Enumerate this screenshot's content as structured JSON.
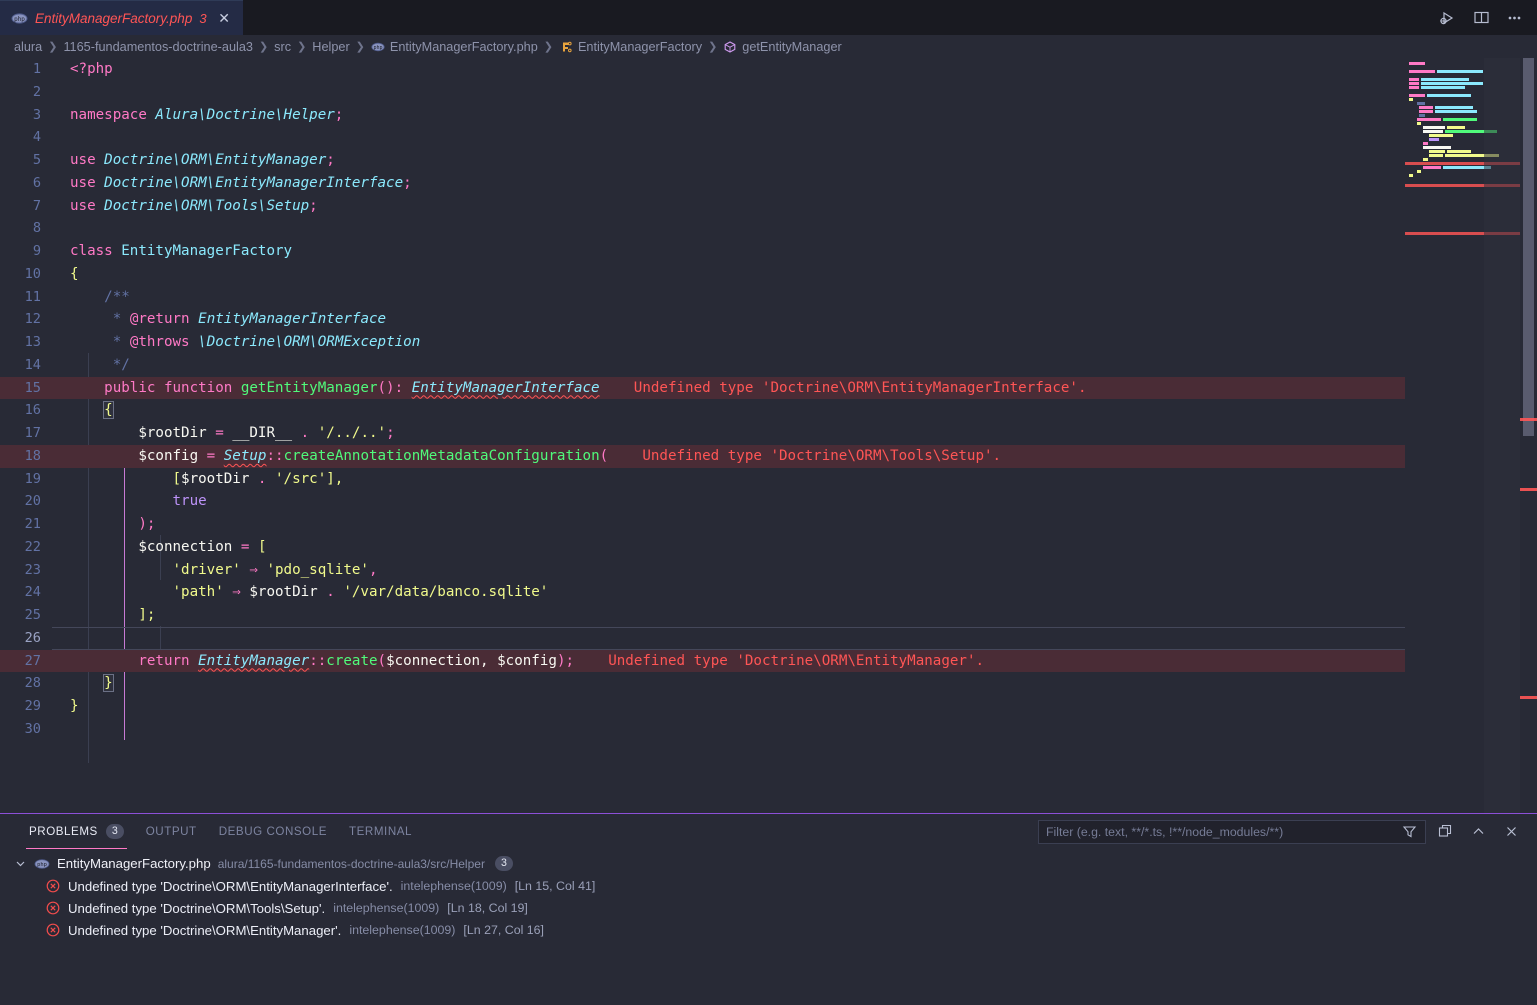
{
  "tab": {
    "icon": "php-elephant-icon",
    "label": "EntityManagerFactory.php",
    "error_badge": "3",
    "close": "✕"
  },
  "editor_actions": [
    {
      "name": "run-and-debug-icon",
      "label": "Run or Debug"
    },
    {
      "name": "split-editor-icon",
      "label": "Split Editor Right"
    },
    {
      "name": "more-actions-icon",
      "label": "⋯"
    }
  ],
  "breadcrumb": [
    {
      "label": "alura",
      "icon": null
    },
    {
      "label": "1165-fundamentos-doctrine-aula3",
      "icon": null
    },
    {
      "label": "src",
      "icon": null
    },
    {
      "label": "Helper",
      "icon": null
    },
    {
      "label": "EntityManagerFactory.php",
      "icon": "php-elephant-icon"
    },
    {
      "label": "EntityManagerFactory",
      "icon": "class-symbol-icon"
    },
    {
      "label": "getEntityManager",
      "icon": "method-symbol-icon"
    }
  ],
  "code": {
    "language": "php",
    "first_line": 1,
    "last_line": 30,
    "lines": [
      {
        "n": 1,
        "text": "<?php"
      },
      {
        "n": 2,
        "text": ""
      },
      {
        "n": 3,
        "text": "namespace Alura\\Doctrine\\Helper;"
      },
      {
        "n": 4,
        "text": ""
      },
      {
        "n": 5,
        "text": "use Doctrine\\ORM\\EntityManager;"
      },
      {
        "n": 6,
        "text": "use Doctrine\\ORM\\EntityManagerInterface;"
      },
      {
        "n": 7,
        "text": "use Doctrine\\ORM\\Tools\\Setup;"
      },
      {
        "n": 8,
        "text": ""
      },
      {
        "n": 9,
        "text": "class EntityManagerFactory"
      },
      {
        "n": 10,
        "text": "{"
      },
      {
        "n": 11,
        "text": "    /**"
      },
      {
        "n": 12,
        "text": "     * @return EntityManagerInterface"
      },
      {
        "n": 13,
        "text": "     * @throws \\Doctrine\\ORM\\ORMException"
      },
      {
        "n": 14,
        "text": "     */"
      },
      {
        "n": 15,
        "text": "    public function getEntityManager(): EntityManagerInterface"
      },
      {
        "n": 16,
        "text": "    {"
      },
      {
        "n": 17,
        "text": "        $rootDir = __DIR__ . '/../..';"
      },
      {
        "n": 18,
        "text": "        $config = Setup::createAnnotationMetadataConfiguration("
      },
      {
        "n": 19,
        "text": "            [$rootDir . '/src'],"
      },
      {
        "n": 20,
        "text": "            true"
      },
      {
        "n": 21,
        "text": "        );"
      },
      {
        "n": 22,
        "text": "        $connection = ["
      },
      {
        "n": 23,
        "text": "            'driver' => 'pdo_sqlite',"
      },
      {
        "n": 24,
        "text": "            'path' => $rootDir . '/var/data/banco.sqlite'"
      },
      {
        "n": 25,
        "text": "        ];"
      },
      {
        "n": 26,
        "text": ""
      },
      {
        "n": 27,
        "text": "        return EntityManager::create($connection, $config);"
      },
      {
        "n": 28,
        "text": "    }"
      },
      {
        "n": 29,
        "text": "}"
      },
      {
        "n": 30,
        "text": ""
      }
    ],
    "inline_errors": [
      {
        "line": 15,
        "message": "Undefined type 'Doctrine\\ORM\\EntityManagerInterface'."
      },
      {
        "line": 18,
        "message": "Undefined type 'Doctrine\\ORM\\Tools\\Setup'."
      },
      {
        "line": 27,
        "message": "Undefined type 'Doctrine\\ORM\\EntityManager'."
      }
    ],
    "tokens": {
      "l1_php": "<?php",
      "l3_kw": "namespace",
      "l3_ns": "Alura\\Doctrine\\Helper",
      "l3_semi": ";",
      "l5_kw": "use",
      "l5_ns": "Doctrine\\ORM\\EntityManager",
      "l6_kw": "use",
      "l6_ns": "Doctrine\\ORM\\EntityManagerInterface",
      "l7_kw": "use",
      "l7_ns": "Doctrine\\ORM\\Tools\\Setup",
      "l9_kw": "class",
      "l9_name": "EntityManagerFactory",
      "l10_brace": "{",
      "l11_doc": "/**",
      "l12_star": "* ",
      "l12_tag": "@return",
      "l12_type": "EntityManagerInterface",
      "l13_star": "* ",
      "l13_tag": "@throws",
      "l13_type": "\\Doctrine\\ORM\\ORMException",
      "l14_doc": "*/",
      "l15_mod": "public function",
      "l15_fn": "getEntityManager",
      "l15_parens": "(): ",
      "l15_ret": "EntityManagerInterface",
      "l16_brace": "{",
      "l17_var": "$rootDir",
      "l17_eq": " = ",
      "l17_const": "__DIR__",
      "l17_concat": " . ",
      "l17_str": "'/../..'",
      "l17_semi": ";",
      "l18_var": "$config",
      "l18_eq": " = ",
      "l18_cls": "Setup",
      "l18_dcol": "::",
      "l18_fn": "createAnnotationMetadataConfiguration",
      "l18_open": "(",
      "l19_open": "[",
      "l19_var": "$rootDir",
      "l19_concat": " . ",
      "l19_str": "'/src'",
      "l19_close": "],",
      "l20_true": "true",
      "l21_close": ");",
      "l22_var": "$connection",
      "l22_eq": " = ",
      "l22_open": "[",
      "l23_key": "'driver'",
      "l23_arrow": " ⇒ ",
      "l23_val": "'pdo_sqlite'",
      "l23_comma": ",",
      "l24_key": "'path'",
      "l24_arrow": " ⇒ ",
      "l24_var": "$rootDir",
      "l24_concat": " . ",
      "l24_val": "'/var/data/banco.sqlite'",
      "l25_close": "];",
      "l27_kw": "return",
      "l27_cls": "EntityManager",
      "l27_dcol": "::",
      "l27_fn": "create",
      "l27_args_open": "(",
      "l27_a1": "$connection",
      "l27_comma": ", ",
      "l27_a2": "$config",
      "l27_args_close": ");",
      "l28_brace": "}",
      "l29_brace": "}"
    }
  },
  "panel": {
    "tabs": [
      {
        "label": "PROBLEMS",
        "badge": "3",
        "active": true
      },
      {
        "label": "OUTPUT",
        "badge": null,
        "active": false
      },
      {
        "label": "DEBUG CONSOLE",
        "badge": null,
        "active": false
      },
      {
        "label": "TERMINAL",
        "badge": null,
        "active": false
      }
    ],
    "filter": {
      "value": "",
      "placeholder": "Filter (e.g. text, **/*.ts, !**/node_modules/**)"
    },
    "actions": [
      {
        "name": "filter-icon",
        "label": "Filter"
      },
      {
        "name": "view-as-table-icon",
        "label": "View as Table"
      },
      {
        "name": "chevron-up-icon",
        "label": "Maximize Panel Size"
      },
      {
        "name": "close-panel-icon",
        "label": "Close Panel"
      }
    ],
    "problems": {
      "file": {
        "name": "EntityManagerFactory.php",
        "path": "alura/1165-fundamentos-doctrine-aula3/src/Helper",
        "count": "3",
        "expanded": true,
        "icon": "php-elephant-icon"
      },
      "items": [
        {
          "severity": "error",
          "message": "Undefined type 'Doctrine\\ORM\\EntityManagerInterface'.",
          "source": "intelephense(1009)",
          "location": "[Ln 15, Col 41]"
        },
        {
          "severity": "error",
          "message": "Undefined type 'Doctrine\\ORM\\Tools\\Setup'.",
          "source": "intelephense(1009)",
          "location": "[Ln 18, Col 19]"
        },
        {
          "severity": "error",
          "message": "Undefined type 'Doctrine\\ORM\\EntityManager'.",
          "source": "intelephense(1009)",
          "location": "[Ln 27, Col 16]"
        }
      ]
    }
  },
  "colors": {
    "background": "#282a36",
    "tab_active_bg": "#242b45",
    "error_red": "#ff5555",
    "error_line_bg": "#4a2c36",
    "keyword_pink": "#ff79c6",
    "type_cyan": "#8be9fd",
    "function_green": "#50fa7b",
    "string_yellow": "#f1fa8c",
    "comment_blue": "#6272a4",
    "constant_purple": "#bd93f9",
    "panel_focus_border": "#8c4fd8",
    "active_indent_guide": "#c77ad4"
  }
}
